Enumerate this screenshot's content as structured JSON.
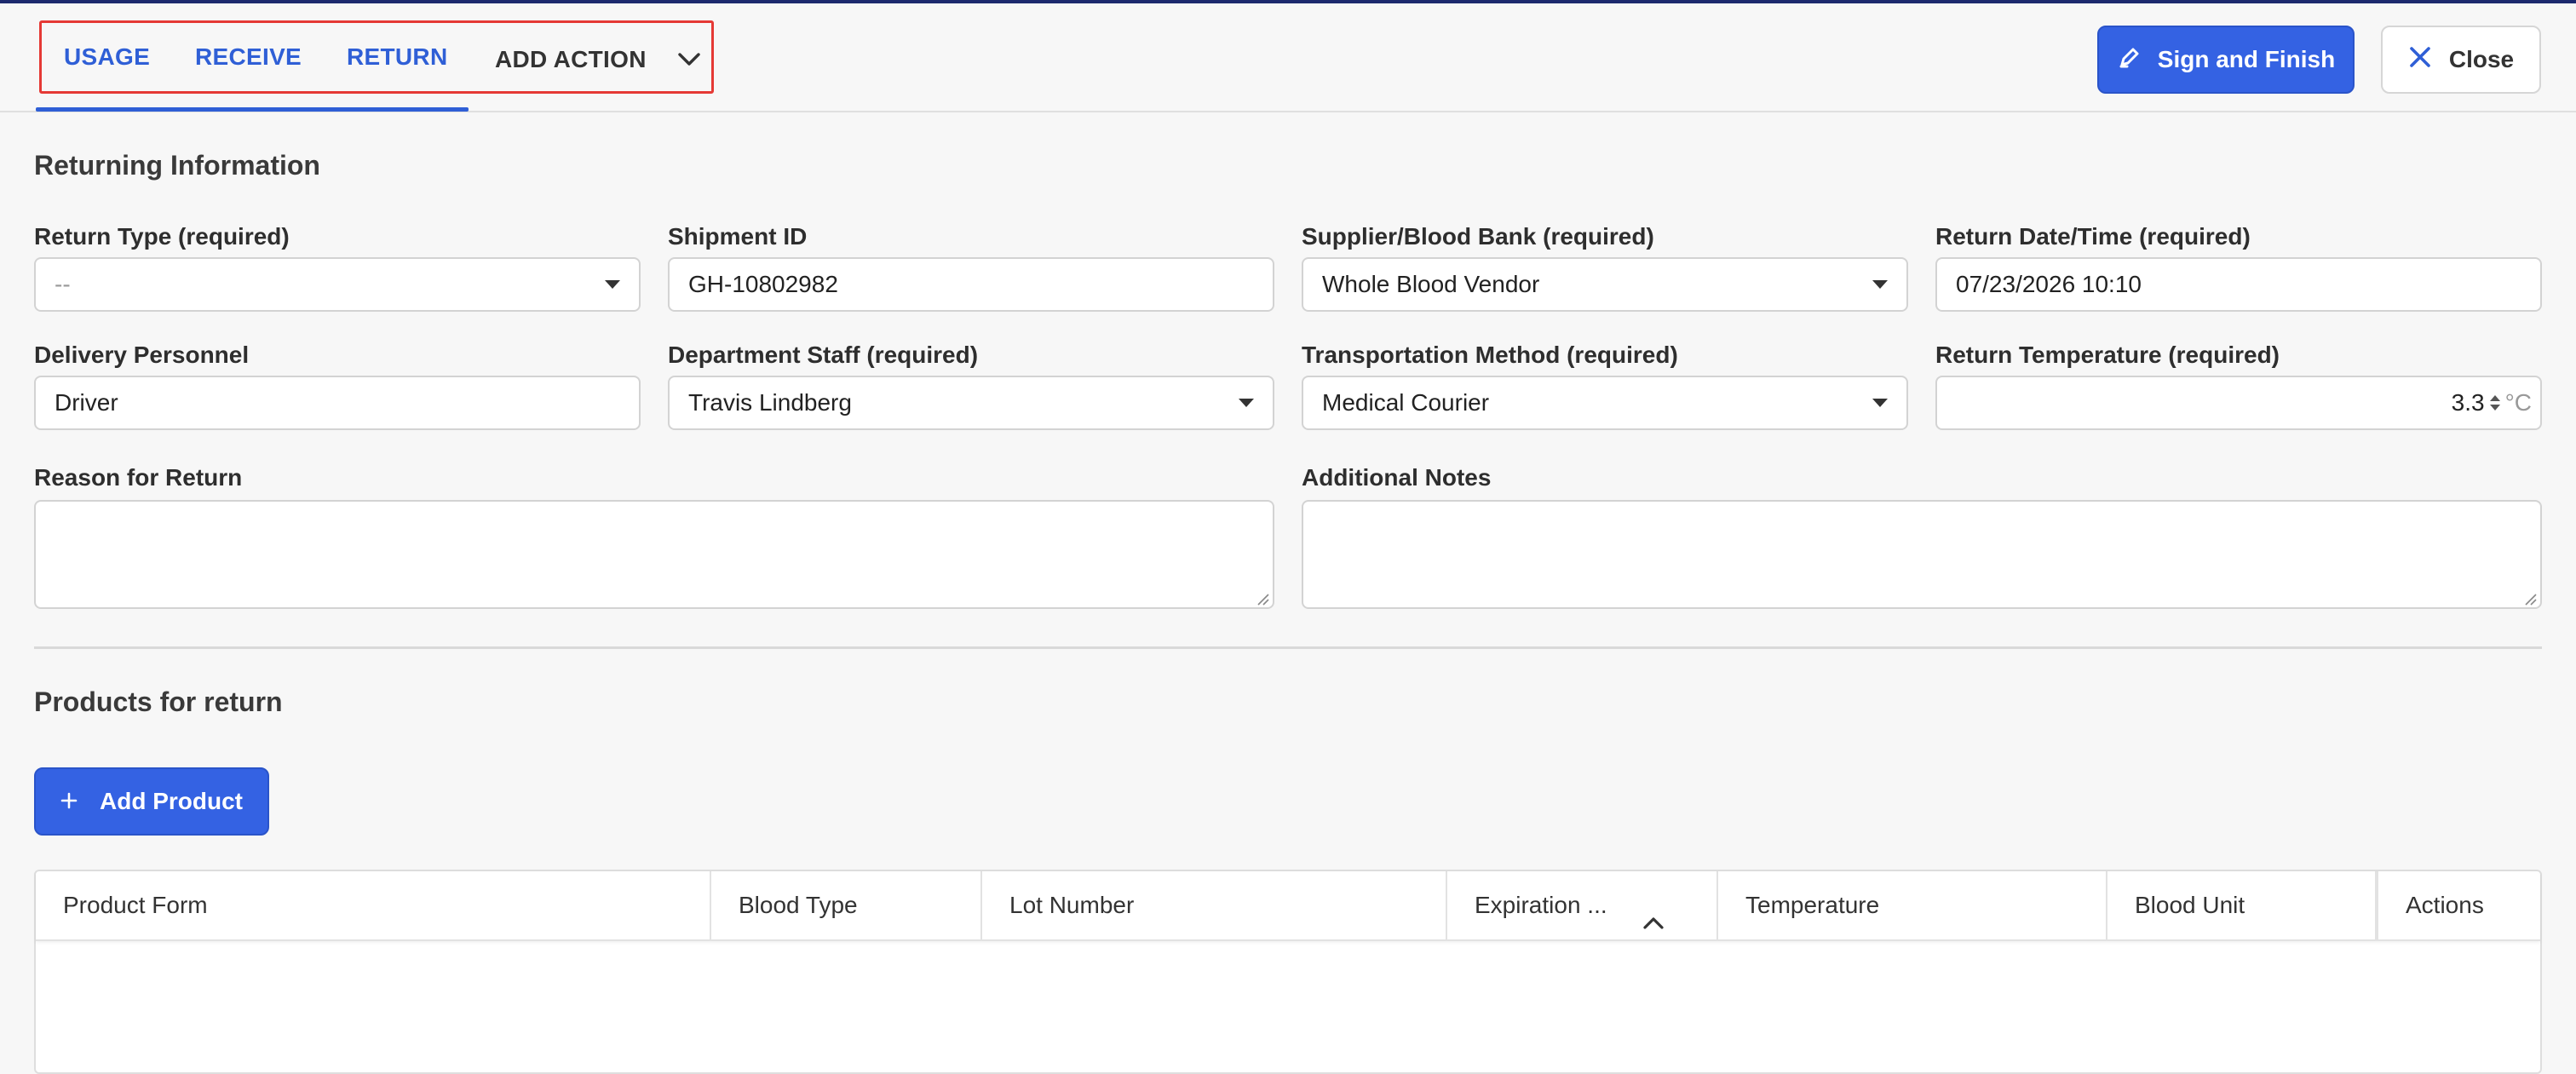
{
  "tabs": {
    "usage": "USAGE",
    "receive": "RECEIVE",
    "return": "RETURN",
    "add_action": "ADD ACTION"
  },
  "toolbar": {
    "sign_finish": "Sign and Finish",
    "close": "Close"
  },
  "returning": {
    "title": "Returning Information",
    "return_type": {
      "label": "Return Type (required)",
      "value": "--"
    },
    "shipment_id": {
      "label": "Shipment ID",
      "value": "GH-10802982"
    },
    "supplier": {
      "label": "Supplier/Blood Bank (required)",
      "value": "Whole Blood Vendor"
    },
    "return_datetime": {
      "label": "Return Date/Time (required)",
      "value": "07/23/2026 10:10"
    },
    "delivery_personnel": {
      "label": "Delivery Personnel",
      "value": "Driver"
    },
    "department_staff": {
      "label": "Department Staff (required)",
      "value": "Travis Lindberg"
    },
    "transport_method": {
      "label": "Transportation Method (required)",
      "value": "Medical Courier"
    },
    "return_temperature": {
      "label": "Return Temperature (required)",
      "value": "3.3",
      "unit": "°C"
    },
    "reason": {
      "label": "Reason for Return",
      "value": ""
    },
    "notes": {
      "label": "Additional Notes",
      "value": ""
    }
  },
  "products": {
    "title": "Products for return",
    "add_button": "Add Product",
    "columns": [
      "Product Form",
      "Blood Type",
      "Lot Number",
      "Expiration ...",
      "Temperature",
      "Blood Unit",
      "Actions"
    ],
    "rows": []
  },
  "colors": {
    "accent": "#3462e3",
    "tab_link": "#2f5fd6",
    "highlight_box": "#e53935"
  },
  "icons": {
    "sign": "pencil-icon",
    "close": "close-icon",
    "add": "plus-icon",
    "dropdown": "chevron-down-icon",
    "sort": "chevron-up-icon"
  }
}
